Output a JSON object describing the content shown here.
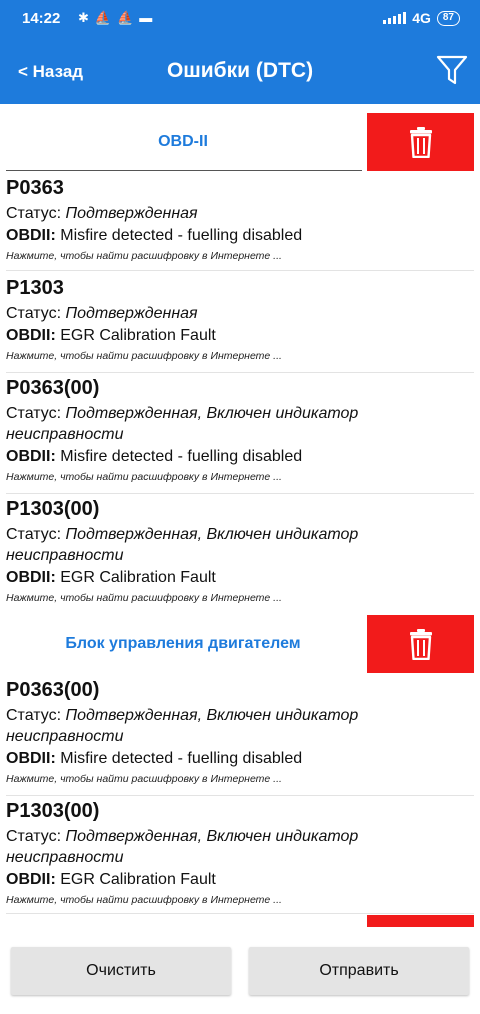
{
  "status_bar": {
    "time": "14:22",
    "network": "4G",
    "battery": "87"
  },
  "header": {
    "back_label": "< Назад",
    "title": "Ошибки (DTC)"
  },
  "sections": [
    {
      "title": "OBD-II",
      "items": [
        {
          "code": "P0363",
          "status_label": "Статус:",
          "status_value": "Подтвержденная",
          "source": "OBDII:",
          "description": "Misfire detected - fuelling disabled",
          "hint": "Нажмите, чтобы найти расшифровку в Интернете ..."
        },
        {
          "code": "P1303",
          "status_label": "Статус:",
          "status_value": "Подтвержденная",
          "source": "OBDII:",
          "description": "EGR Calibration Fault",
          "hint": "Нажмите, чтобы найти расшифровку в Интернете ..."
        },
        {
          "code": "P0363(00)",
          "status_label": "Статус:",
          "status_value": "Подтвержденная, Включен индикатор неисправности",
          "source": "OBDII:",
          "description": "Misfire detected - fuelling disabled",
          "hint": "Нажмите, чтобы найти расшифровку в Интернете ..."
        },
        {
          "code": "P1303(00)",
          "status_label": "Статус:",
          "status_value": "Подтвержденная, Включен индикатор неисправности",
          "source": "OBDII:",
          "description": "EGR Calibration Fault",
          "hint": "Нажмите, чтобы найти расшифровку в Интернете ..."
        }
      ]
    },
    {
      "title": "Блок управления двигателем",
      "items": [
        {
          "code": "P0363(00)",
          "status_label": "Статус:",
          "status_value": "Подтвержденная, Включен индикатор неисправности",
          "source": "OBDII:",
          "description": "Misfire detected - fuelling disabled",
          "hint": "Нажмите, чтобы найти расшифровку в Интернете ..."
        },
        {
          "code": "P1303(00)",
          "status_label": "Статус:",
          "status_value": "Подтвержденная, Включен индикатор неисправности",
          "source": "OBDII:",
          "description": "EGR Calibration Fault",
          "hint": "Нажмите, чтобы найти расшифровку в Интернете ..."
        }
      ]
    }
  ],
  "footer": {
    "clear_label": "Очистить",
    "send_label": "Отправить"
  },
  "colors": {
    "primary": "#1e7bdc",
    "delete": "#f21b1b",
    "footer_button": "#e4e4e4"
  }
}
